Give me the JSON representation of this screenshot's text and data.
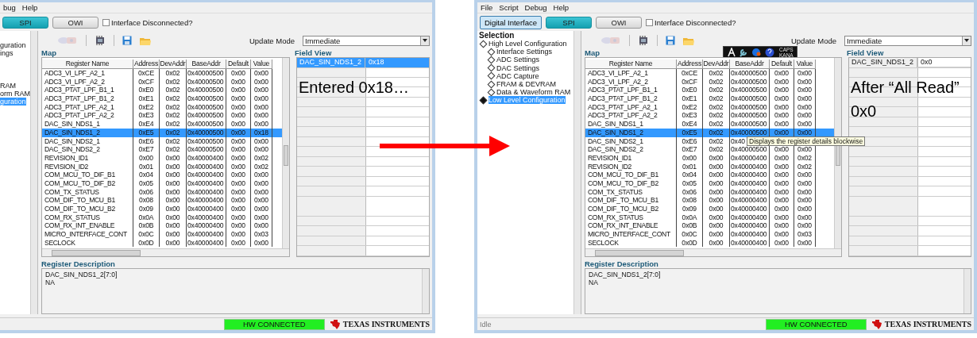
{
  "windows": [
    {
      "menu": [
        {
          "label": "bug"
        },
        {
          "label": "Help"
        }
      ],
      "interface_buttons": [
        {
          "label": "SPI",
          "selected": true
        },
        {
          "label": "OWI",
          "selected": false
        }
      ],
      "interface_disconnected": {
        "label": "Interface Disconnected?",
        "checked": false
      },
      "sidebar": {
        "cut": true,
        "items": [
          {
            "label": "guration",
            "selected": false,
            "children": [
              {
                "label": "ings",
                "selected": false
              },
              {
                "selected": false
              },
              {
                "selected": false
              },
              {
                "selected": false
              },
              {
                "label": "RAM",
                "selected": false
              },
              {
                "label": "orm RAM",
                "selected": false
              }
            ]
          },
          {
            "label": "guration",
            "selected": true
          }
        ]
      },
      "update_mode": {
        "label": "Update Mode",
        "value": "Immediate"
      },
      "map": {
        "title": "Map",
        "columns": [
          "Register Name",
          "Address",
          "DevAddr",
          "BaseAddr",
          "Default",
          "Value"
        ],
        "rows": [
          {
            "cells": [
              "ADC3_VI_LPF_A2_1",
              "0xCE",
              "0x02",
              "0x40000500",
              "0x00",
              "0x00"
            ],
            "selected": false
          },
          {
            "cells": [
              "ADC3_VI_LPF_A2_2",
              "0xCF",
              "0x02",
              "0x40000500",
              "0x00",
              "0x00"
            ],
            "selected": false
          },
          {
            "cells": [
              "ADC3_PTAT_LPF_B1_1",
              "0xE0",
              "0x02",
              "0x40000500",
              "0x00",
              "0x00"
            ],
            "selected": false
          },
          {
            "cells": [
              "ADC3_PTAT_LPF_B1_2",
              "0xE1",
              "0x02",
              "0x40000500",
              "0x00",
              "0x00"
            ],
            "selected": false
          },
          {
            "cells": [
              "ADC3_PTAT_LPF_A2_1",
              "0xE2",
              "0x02",
              "0x40000500",
              "0x00",
              "0x00"
            ],
            "selected": false
          },
          {
            "cells": [
              "ADC3_PTAT_LPF_A2_2",
              "0xE3",
              "0x02",
              "0x40000500",
              "0x00",
              "0x00"
            ],
            "selected": false
          },
          {
            "cells": [
              "DAC_SIN_NDS1_1",
              "0xE4",
              "0x02",
              "0x40000500",
              "0x00",
              "0x00"
            ],
            "selected": false
          },
          {
            "cells": [
              "DAC_SIN_NDS1_2",
              "0xE5",
              "0x02",
              "0x40000500",
              "0x00",
              "0x18"
            ],
            "selected": true
          },
          {
            "cells": [
              "DAC_SIN_NDS2_1",
              "0xE6",
              "0x02",
              "0x40000500",
              "0x00",
              "0x00"
            ],
            "selected": false
          },
          {
            "cells": [
              "DAC_SIN_NDS2_2",
              "0xE7",
              "0x02",
              "0x40000500",
              "0x00",
              "0x00"
            ],
            "selected": false
          },
          {
            "cells": [
              "REVISION_ID1",
              "0x00",
              "0x00",
              "0x40000400",
              "0x00",
              "0x02"
            ],
            "selected": false
          },
          {
            "cells": [
              "REVISION_ID2",
              "0x01",
              "0x00",
              "0x40000400",
              "0x00",
              "0x02"
            ],
            "selected": false
          },
          {
            "cells": [
              "COM_MCU_TO_DIF_B1",
              "0x04",
              "0x00",
              "0x40000400",
              "0x00",
              "0x00"
            ],
            "selected": false
          },
          {
            "cells": [
              "COM_MCU_TO_DIF_B2",
              "0x05",
              "0x00",
              "0x40000400",
              "0x00",
              "0x00"
            ],
            "selected": false
          },
          {
            "cells": [
              "COM_TX_STATUS",
              "0x06",
              "0x00",
              "0x40000400",
              "0x00",
              "0x00"
            ],
            "selected": false
          },
          {
            "cells": [
              "COM_DIF_TO_MCU_B1",
              "0x08",
              "0x00",
              "0x40000400",
              "0x00",
              "0x00"
            ],
            "selected": false
          },
          {
            "cells": [
              "COM_DIF_TO_MCU_B2",
              "0x09",
              "0x00",
              "0x40000400",
              "0x00",
              "0x00"
            ],
            "selected": false
          },
          {
            "cells": [
              "COM_RX_STATUS",
              "0x0A",
              "0x00",
              "0x40000400",
              "0x00",
              "0x00"
            ],
            "selected": false
          },
          {
            "cells": [
              "COM_RX_INT_ENABLE",
              "0x0B",
              "0x00",
              "0x40000400",
              "0x00",
              "0x00"
            ],
            "selected": false
          },
          {
            "cells": [
              "MICRO_INTERFACE_CONT",
              "0x0C",
              "0x00",
              "0x40000400",
              "0x00",
              "0x03"
            ],
            "selected": false
          },
          {
            "cells": [
              "SECLOCK",
              "0x0D",
              "0x00",
              "0x40000400",
              "0x00",
              "0x00"
            ],
            "selected": false
          }
        ]
      },
      "field_view": {
        "title": "Field View",
        "rows": [
          {
            "name": "DAC_SIN_NDS1_2",
            "value": "0x18",
            "selected": true
          }
        ]
      },
      "annotation": [
        "Entered 0x18…"
      ],
      "register_description": {
        "title": "Register Description",
        "lines": [
          "DAC_SIN_NDS1_2[7:0]",
          "NA"
        ]
      },
      "status_bar": {
        "hw_status": "HW CONNECTED",
        "logo": "TEXAS INSTRUMENTS"
      }
    },
    {
      "menu": [
        {
          "label": "File"
        },
        {
          "label": "Script"
        },
        {
          "label": "Debug"
        },
        {
          "label": "Help"
        }
      ],
      "mode_button": {
        "label": "Digital Interface"
      },
      "interface_buttons": [
        {
          "label": "SPI",
          "selected": true
        },
        {
          "label": "OWI",
          "selected": false
        }
      ],
      "interface_disconnected": {
        "label": "Interface Disconnected?",
        "checked": false
      },
      "sidebar": {
        "cut": false,
        "title": "Selection",
        "items": [
          {
            "label": "High Level Configuration",
            "selected": false,
            "children": [
              {
                "label": "Interface Settings",
                "selected": false
              },
              {
                "label": "ADC Settings",
                "selected": false
              },
              {
                "label": "DAC Settings",
                "selected": false
              },
              {
                "label": "ADC Capture",
                "selected": false
              },
              {
                "label": "FRAM & DEVRAM",
                "selected": false
              },
              {
                "label": "Data & Waveform RAM",
                "selected": false
              }
            ]
          },
          {
            "label": "Low Level Configuration",
            "selected": true
          }
        ]
      },
      "update_mode": {
        "label": "Update Mode",
        "value": "Immediate"
      },
      "map": {
        "title": "Map",
        "columns": [
          "Register Name",
          "Address",
          "DevAddr",
          "BaseAddr",
          "Default",
          "Value"
        ],
        "rows": [
          {
            "cells": [
              "ADC3_VI_LPF_A2_1",
              "0xCE",
              "0x02",
              "0x40000500",
              "0x00",
              "0x00"
            ],
            "selected": false
          },
          {
            "cells": [
              "ADC3_VI_LPF_A2_2",
              "0xCF",
              "0x02",
              "0x40000500",
              "0x00",
              "0x00"
            ],
            "selected": false
          },
          {
            "cells": [
              "ADC3_PTAT_LPF_B1_1",
              "0xE0",
              "0x02",
              "0x40000500",
              "0x00",
              "0x00"
            ],
            "selected": false
          },
          {
            "cells": [
              "ADC3_PTAT_LPF_B1_2",
              "0xE1",
              "0x02",
              "0x40000500",
              "0x00",
              "0x00"
            ],
            "selected": false
          },
          {
            "cells": [
              "ADC3_PTAT_LPF_A2_1",
              "0xE2",
              "0x02",
              "0x40000500",
              "0x00",
              "0x00"
            ],
            "selected": false
          },
          {
            "cells": [
              "ADC3_PTAT_LPF_A2_2",
              "0xE3",
              "0x02",
              "0x40000500",
              "0x00",
              "0x00"
            ],
            "selected": false
          },
          {
            "cells": [
              "DAC_SIN_NDS1_1",
              "0xE4",
              "0x02",
              "0x40000500",
              "0x00",
              "0x00"
            ],
            "selected": false
          },
          {
            "cells": [
              "DAC_SIN_NDS1_2",
              "0xE5",
              "0x02",
              "0x40000500",
              "0x00",
              "0x00"
            ],
            "selected": true
          },
          {
            "cells": [
              "DAC_SIN_NDS2_1",
              "0xE6",
              "0x02",
              "0x40"
            ],
            "selected": false
          },
          {
            "cells": [
              "DAC_SIN_NDS2_2",
              "0xE7",
              "0x02",
              "0x40000500",
              "0x00",
              "0x00"
            ],
            "selected": false
          },
          {
            "cells": [
              "REVISION_ID1",
              "0x00",
              "0x00",
              "0x40000400",
              "0x00",
              "0x02"
            ],
            "selected": false
          },
          {
            "cells": [
              "REVISION_ID2",
              "0x01",
              "0x00",
              "0x40000400",
              "0x00",
              "0x02"
            ],
            "selected": false
          },
          {
            "cells": [
              "COM_MCU_TO_DIF_B1",
              "0x04",
              "0x00",
              "0x40000400",
              "0x00",
              "0x00"
            ],
            "selected": false
          },
          {
            "cells": [
              "COM_MCU_TO_DIF_B2",
              "0x05",
              "0x00",
              "0x40000400",
              "0x00",
              "0x00"
            ],
            "selected": false
          },
          {
            "cells": [
              "COM_TX_STATUS",
              "0x06",
              "0x00",
              "0x40000400",
              "0x00",
              "0x00"
            ],
            "selected": false
          },
          {
            "cells": [
              "COM_DIF_TO_MCU_B1",
              "0x08",
              "0x00",
              "0x40000400",
              "0x00",
              "0x00"
            ],
            "selected": false
          },
          {
            "cells": [
              "COM_DIF_TO_MCU_B2",
              "0x09",
              "0x00",
              "0x40000400",
              "0x00",
              "0x00"
            ],
            "selected": false
          },
          {
            "cells": [
              "COM_RX_STATUS",
              "0x0A",
              "0x00",
              "0x40000400",
              "0x00",
              "0x00"
            ],
            "selected": false
          },
          {
            "cells": [
              "COM_RX_INT_ENABLE",
              "0x0B",
              "0x00",
              "0x40000400",
              "0x00",
              "0x00"
            ],
            "selected": false
          },
          {
            "cells": [
              "MICRO_INTERFACE_CONT",
              "0x0C",
              "0x00",
              "0x40000400",
              "0x00",
              "0x03"
            ],
            "selected": false
          },
          {
            "cells": [
              "SECLOCK",
              "0x0D",
              "0x00",
              "0x40000400",
              "0x00",
              "0x00"
            ],
            "selected": false
          }
        ]
      },
      "field_view": {
        "title": "Field View",
        "rows": [
          {
            "name": "DAC_SIN_NDS1_2",
            "value": "0x0",
            "selected": false
          }
        ]
      },
      "annotation": [
        "After “All Read”",
        "0x0"
      ],
      "register_description": {
        "title": "Register Description",
        "lines": [
          "DAC_SIN_NDS1_2[7:0]",
          "NA"
        ]
      },
      "status_bar": {
        "status": "Idle",
        "hw_status": "HW CONNECTED",
        "logo": "TEXAS INSTRUMENTS"
      },
      "ime_toolbar": {
        "caps": "CAPS",
        "kana": "KANA"
      },
      "tooltip": "Displays the register details blockwise"
    }
  ]
}
